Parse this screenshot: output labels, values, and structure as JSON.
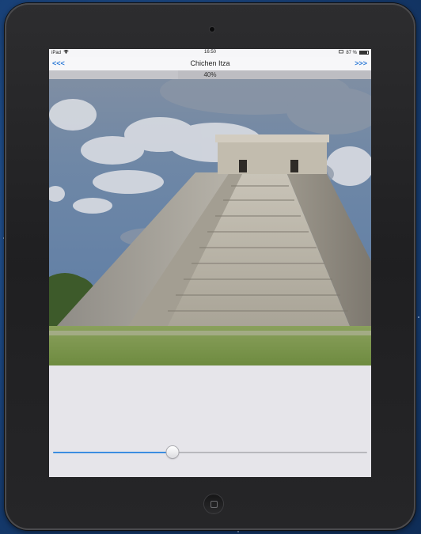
{
  "status_bar": {
    "carrier": "iPad",
    "time": "16:50",
    "battery": "87 %",
    "battery_level": 0.87
  },
  "nav": {
    "prev_label": "<<<",
    "title": "Chichen Itza",
    "next_label": ">>>"
  },
  "progress": {
    "label": "40%",
    "value": 0.4
  },
  "photo": {
    "subject": "pyramid-photo"
  },
  "slider": {
    "value": 0.38
  },
  "colors": {
    "accent": "#2f7bd7",
    "slider_fill": "#3b8de0",
    "screen_bg": "#e6e5ea"
  }
}
